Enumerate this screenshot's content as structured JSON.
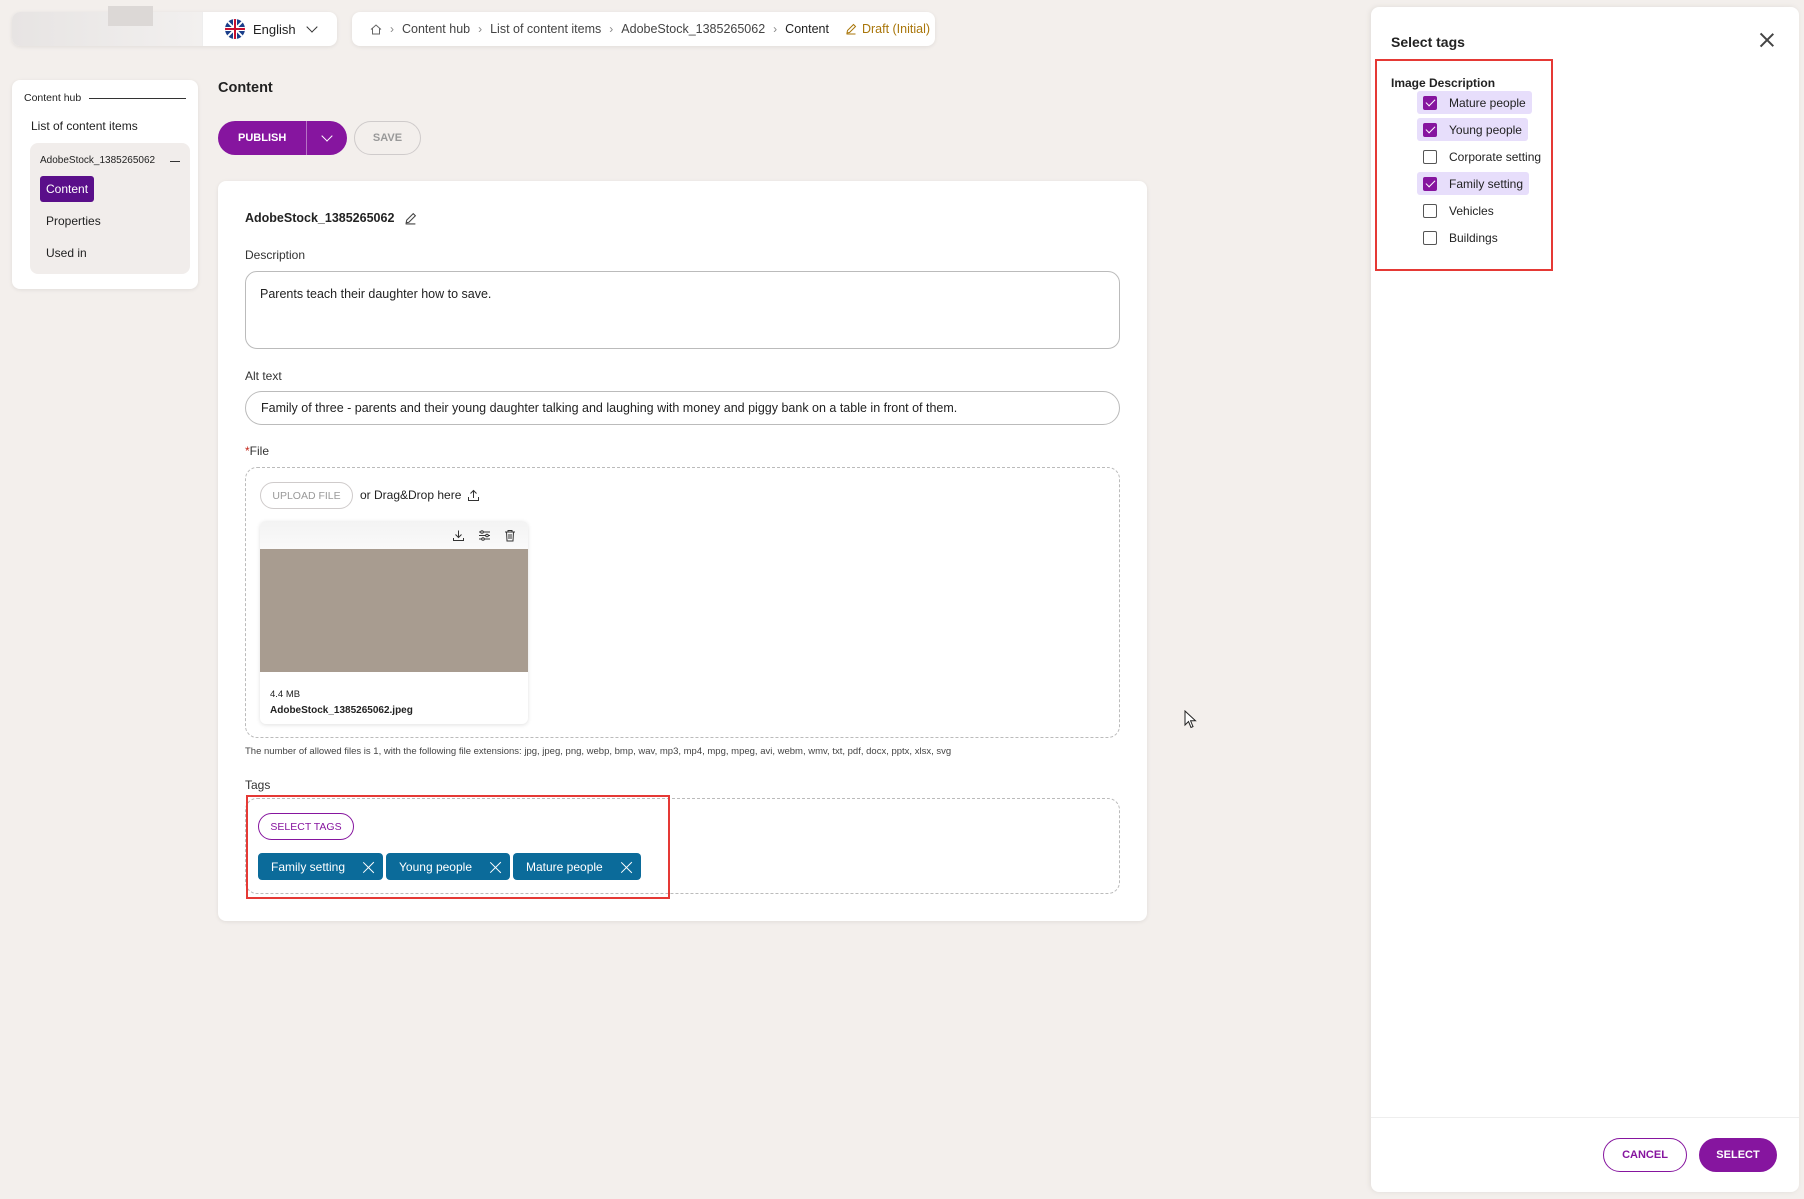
{
  "language": {
    "selected": "English"
  },
  "breadcrumb": {
    "items": [
      "Content hub",
      "List of content items",
      "AdobeStock_1385265062",
      "Content"
    ],
    "status": "Draft (Initial)"
  },
  "left_nav": {
    "hub": "Content hub",
    "list": "List of content items",
    "asset": "AdobeStock_1385265062",
    "items": [
      "Content",
      "Properties",
      "Used in"
    ]
  },
  "page": {
    "title": "Content",
    "publish_label": "PUBLISH",
    "save_label": "SAVE"
  },
  "form": {
    "asset_title": "AdobeStock_1385265062",
    "description_label": "Description",
    "description_value": "Parents teach their daughter how to save.",
    "alt_label": "Alt text",
    "alt_value": "Family of three - parents and their young daughter talking and laughing with money and piggy bank on a table in front of them.",
    "file_label_req": "*",
    "file_label": "File",
    "upload_label": "UPLOAD FILE",
    "drag_text": "or Drag&Drop here",
    "file_size": "4.4 MB",
    "file_name": "AdobeStock_1385265062.jpeg",
    "file_hint": "The number of allowed files is 1, with the following file extensions: jpg, jpeg, png, webp, bmp, wav, mp3, mp4, mpg, mpeg, avi, webm, wmv, txt, pdf, docx, pptx, xlsx, svg",
    "tags_label": "Tags",
    "select_tags_label": "SELECT TAGS",
    "tags": [
      "Family setting",
      "Young people",
      "Mature people"
    ]
  },
  "drawer": {
    "title": "Select tags",
    "group_title": "Image Description",
    "options": [
      {
        "label": "Mature people",
        "checked": true
      },
      {
        "label": "Young people",
        "checked": true
      },
      {
        "label": "Corporate setting",
        "checked": false
      },
      {
        "label": "Family setting",
        "checked": true
      },
      {
        "label": "Vehicles",
        "checked": false
      },
      {
        "label": "Buildings",
        "checked": false
      }
    ],
    "cancel_label": "CANCEL",
    "select_label": "SELECT"
  },
  "colors": {
    "primary": "#86159f",
    "chip": "#0b6b9a",
    "highlight_frame": "#e53935",
    "draft": "#a9760a"
  }
}
